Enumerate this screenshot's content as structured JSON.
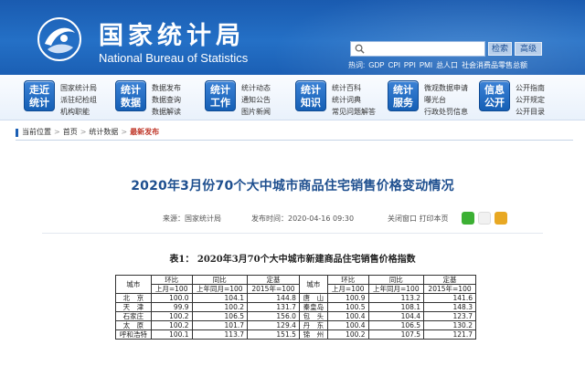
{
  "header": {
    "brand_cn": "国家统计局",
    "brand_en": "National Bureau of Statistics",
    "search_button": "检索",
    "advanced_button": "高级",
    "hot_links": [
      "热词:",
      "GDP",
      "CPI",
      "PPI",
      "PMI",
      "总人口",
      "社会消费品零售总额"
    ]
  },
  "nav": [
    {
      "icon_label": [
        "走近",
        "统计"
      ],
      "links": [
        "国家统计局",
        "派驻纪检组",
        "机构职能"
      ]
    },
    {
      "icon_label": [
        "统计",
        "数据"
      ],
      "links": [
        "数据发布",
        "数据查询",
        "数据解读"
      ]
    },
    {
      "icon_label": [
        "统计",
        "工作"
      ],
      "links": [
        "统计动态",
        "通知公告",
        "图片新闻"
      ]
    },
    {
      "icon_label": [
        "统计",
        "知识"
      ],
      "links": [
        "统计百科",
        "统计词典",
        "常见问题解答"
      ]
    },
    {
      "icon_label": [
        "统计",
        "服务"
      ],
      "links": [
        "微观数据申请",
        "曝光台",
        "行政处罚信息"
      ]
    },
    {
      "icon_label": [
        "信息",
        "公开"
      ],
      "links": [
        "公开指南",
        "公开规定",
        "公开目录"
      ]
    }
  ],
  "breadcrumb": {
    "items": [
      "当前位置",
      "首页",
      "统计数据"
    ],
    "current": "最新发布"
  },
  "article": {
    "title": "2020年3月份70个大中城市商品住宅销售价格变动情况",
    "source": "来源：国家统计局",
    "publish_time": "发布时间：2020-04-16 09:30",
    "tools": "关闭窗口  打印本页"
  },
  "table": {
    "title": "表1：  2020年3月70个大中城市新建商品住宅销售价格指数",
    "col_city": "城市",
    "groups": [
      "环比",
      "同比",
      "定基"
    ],
    "bases": [
      "上月=100",
      "上年同月=100",
      "2015年=100"
    ],
    "rows": [
      [
        "北　京",
        "100.0",
        "104.1",
        "144.8",
        "唐　山",
        "100.9",
        "113.2",
        "141.6"
      ],
      [
        "天　津",
        "99.9",
        "100.2",
        "131.7",
        "秦皇岛",
        "100.5",
        "108.1",
        "148.3"
      ],
      [
        "石家庄",
        "100.2",
        "106.5",
        "156.0",
        "包　头",
        "100.4",
        "104.4",
        "123.7"
      ],
      [
        "太　原",
        "100.2",
        "101.7",
        "129.4",
        "丹　东",
        "100.4",
        "106.5",
        "130.2"
      ],
      [
        "呼和浩特",
        "100.1",
        "113.7",
        "151.5",
        "锦　州",
        "100.2",
        "107.5",
        "121.7"
      ]
    ]
  }
}
